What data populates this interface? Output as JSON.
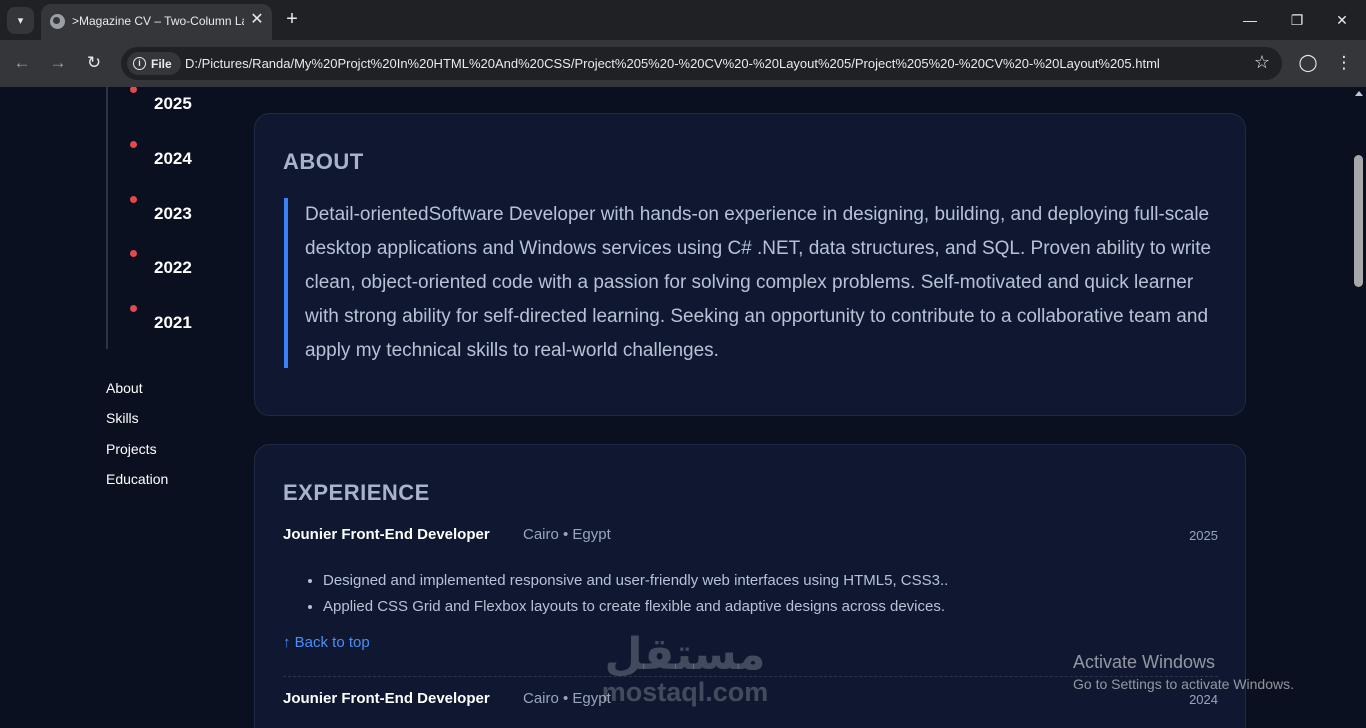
{
  "browser": {
    "tab_title": ">Magazine CV – Two-Column Layout",
    "tab_close": "✕",
    "new_tab": "+",
    "site_chip": "File",
    "url": "D:/Pictures/Randa/My%20Projct%20In%20HTML%20And%20CSS/Project%205%20-%20CV%20-%20Layout%205/Project%205%20-%20CV%20-%20Layout%205.html",
    "icons": [
      "tab-list-icon",
      "globe-icon",
      "back-arrow-icon",
      "forward-arrow-icon",
      "reload-icon",
      "info-icon",
      "star-icon",
      "profile-icon",
      "kebab-menu-icon",
      "minimize-icon",
      "restore-icon",
      "close-icon"
    ]
  },
  "timeline": {
    "years": [
      "2025",
      "2024",
      "2023",
      "2022",
      "2021"
    ],
    "dot_color": "#e5484d"
  },
  "side_nav": [
    "About",
    "Skills",
    "Projects",
    "Education"
  ],
  "about": {
    "title": "ABOUT",
    "text": "Detail-orientedSoftware Developer with hands-on experience in designing, building, and deploying full-scale desktop applications and Windows services using C# .NET, data structures, and SQL. Proven ability to write clean, object-oriented code with a passion for solving complex problems. Self-motivated and quick learner with strong ability for self-directed learning. Seeking an opportunity to contribute to a collaborative team and apply my technical skills to real-world challenges.",
    "accent": "#3b82f6"
  },
  "experience": {
    "title": "EXPERIENCE",
    "jobs": [
      {
        "title": "Jounier Front-End Developer",
        "location": "Cairo • Egypt",
        "year": "2025",
        "bullets": [
          "Designed and implemented responsive and user-friendly web interfaces using HTML5, CSS3..",
          "Applied CSS Grid and Flexbox layouts to create flexible and adaptive designs across devices."
        ],
        "back_to_top": "↑ Back to top"
      },
      {
        "title": "Jounier Front-End Developer",
        "location": "Cairo • Egypt",
        "year": "2024"
      }
    ]
  },
  "overlays": {
    "watermark_arabic": "مستقل",
    "watermark_latin": "mostaql.com",
    "activate_title": "Activate Windows",
    "activate_sub": "Go to Settings to activate Windows."
  }
}
